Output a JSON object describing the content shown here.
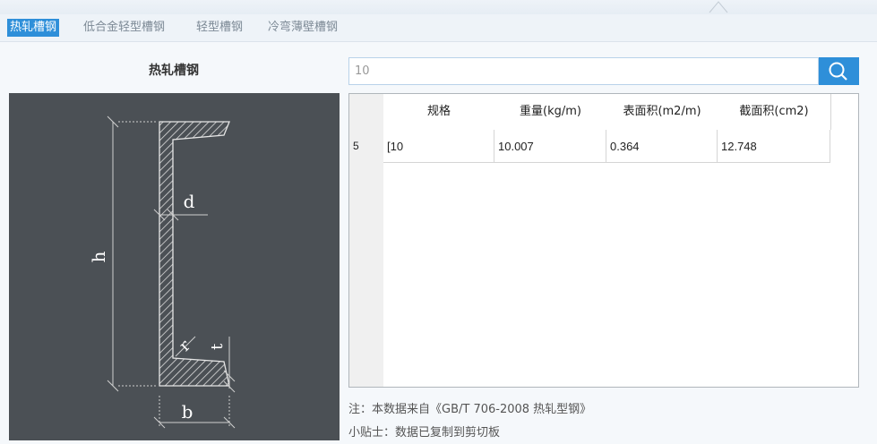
{
  "tabs": [
    {
      "label": "热轧槽钢"
    },
    {
      "label": "低合金轻型槽钢"
    },
    {
      "label": "轻型槽钢"
    },
    {
      "label": "冷弯薄壁槽钢"
    }
  ],
  "left_panel": {
    "title": "热轧槽钢",
    "diagram_labels": {
      "h": "h",
      "d": "d",
      "b": "b",
      "r": "r",
      "t": "t"
    }
  },
  "search": {
    "value": "10"
  },
  "table": {
    "columns": [
      "规格",
      "重量(kg/m)",
      "表面积(m2/m)",
      "截面积(cm2)"
    ],
    "rows": [
      {
        "index": "5",
        "cells": [
          "[10",
          "10.007",
          "0.364",
          "12.748"
        ]
      }
    ]
  },
  "notes": {
    "source": "注：本数据来自《GB/T  706-2008 热轧型钢》",
    "tip": "小贴士：数据已复制到剪切板"
  },
  "colors": {
    "accent": "#2e8fd9",
    "diagram_bg": "#4b5055"
  }
}
